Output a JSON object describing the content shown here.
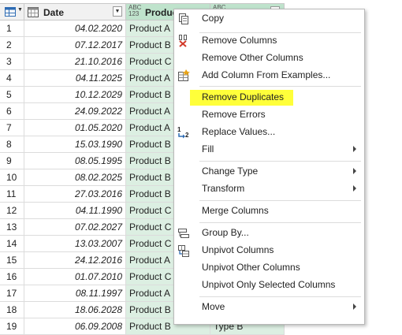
{
  "grid": {
    "columns": [
      {
        "name": "Date"
      },
      {
        "name": "Product",
        "type_badge_top": "ABC",
        "type_badge_bottom": "123"
      },
      {
        "name": "",
        "type_badge_top": "ABC",
        "type_badge_bottom": ""
      }
    ],
    "rows": [
      {
        "n": "1",
        "date": "04.02.2020",
        "product": "Product A",
        "type": ""
      },
      {
        "n": "2",
        "date": "07.12.2017",
        "product": "Product B",
        "type": ""
      },
      {
        "n": "3",
        "date": "21.10.2016",
        "product": "Product C",
        "type": ""
      },
      {
        "n": "4",
        "date": "04.11.2025",
        "product": "Product A",
        "type": ""
      },
      {
        "n": "5",
        "date": "10.12.2029",
        "product": "Product B",
        "type": ""
      },
      {
        "n": "6",
        "date": "24.09.2022",
        "product": "Product A",
        "type": ""
      },
      {
        "n": "7",
        "date": "01.05.2020",
        "product": "Product A",
        "type": ""
      },
      {
        "n": "8",
        "date": "15.03.1990",
        "product": "Product B",
        "type": ""
      },
      {
        "n": "9",
        "date": "08.05.1995",
        "product": "Product B",
        "type": ""
      },
      {
        "n": "10",
        "date": "08.02.2025",
        "product": "Product B",
        "type": ""
      },
      {
        "n": "11",
        "date": "27.03.2016",
        "product": "Product B",
        "type": ""
      },
      {
        "n": "12",
        "date": "04.11.1990",
        "product": "Product C",
        "type": ""
      },
      {
        "n": "13",
        "date": "07.02.2027",
        "product": "Product C",
        "type": ""
      },
      {
        "n": "14",
        "date": "13.03.2007",
        "product": "Product C",
        "type": ""
      },
      {
        "n": "15",
        "date": "24.12.2016",
        "product": "Product A",
        "type": ""
      },
      {
        "n": "16",
        "date": "01.07.2010",
        "product": "Product C",
        "type": ""
      },
      {
        "n": "17",
        "date": "08.11.1997",
        "product": "Product A",
        "type": ""
      },
      {
        "n": "18",
        "date": "18.06.2028",
        "product": "Product B",
        "type": ""
      },
      {
        "n": "19",
        "date": "06.09.2008",
        "product": "Product B",
        "type": "Type B"
      }
    ]
  },
  "context_menu": {
    "items": [
      {
        "label": "Copy",
        "icon": "copy-icon"
      },
      {
        "label": "Remove Columns",
        "icon": "remove-columns-icon"
      },
      {
        "label": "Remove Other Columns",
        "icon": ""
      },
      {
        "label": "Add Column From Examples...",
        "icon": "add-column-examples-icon"
      },
      {
        "label": "Remove Duplicates",
        "icon": "",
        "highlight_color": "#ffff3a"
      },
      {
        "label": "Remove Errors",
        "icon": ""
      },
      {
        "label": "Replace Values...",
        "icon": "replace-values-icon"
      },
      {
        "label": "Fill",
        "icon": "",
        "submenu": true
      },
      {
        "label": "Change Type",
        "icon": "",
        "submenu": true
      },
      {
        "label": "Transform",
        "icon": "",
        "submenu": true
      },
      {
        "label": "Merge Columns",
        "icon": ""
      },
      {
        "label": "Group By...",
        "icon": "group-by-icon"
      },
      {
        "label": "Unpivot Columns",
        "icon": "unpivot-columns-icon"
      },
      {
        "label": "Unpivot Other Columns",
        "icon": ""
      },
      {
        "label": "Unpivot Only Selected Columns",
        "icon": ""
      },
      {
        "label": "Move",
        "icon": "",
        "submenu": true
      }
    ]
  },
  "colors": {
    "selected_column": "#dcefe2",
    "selected_header": "#bfe3cc",
    "highlight": "#ffff3a",
    "remove_icon_red": "#d23a2a"
  }
}
